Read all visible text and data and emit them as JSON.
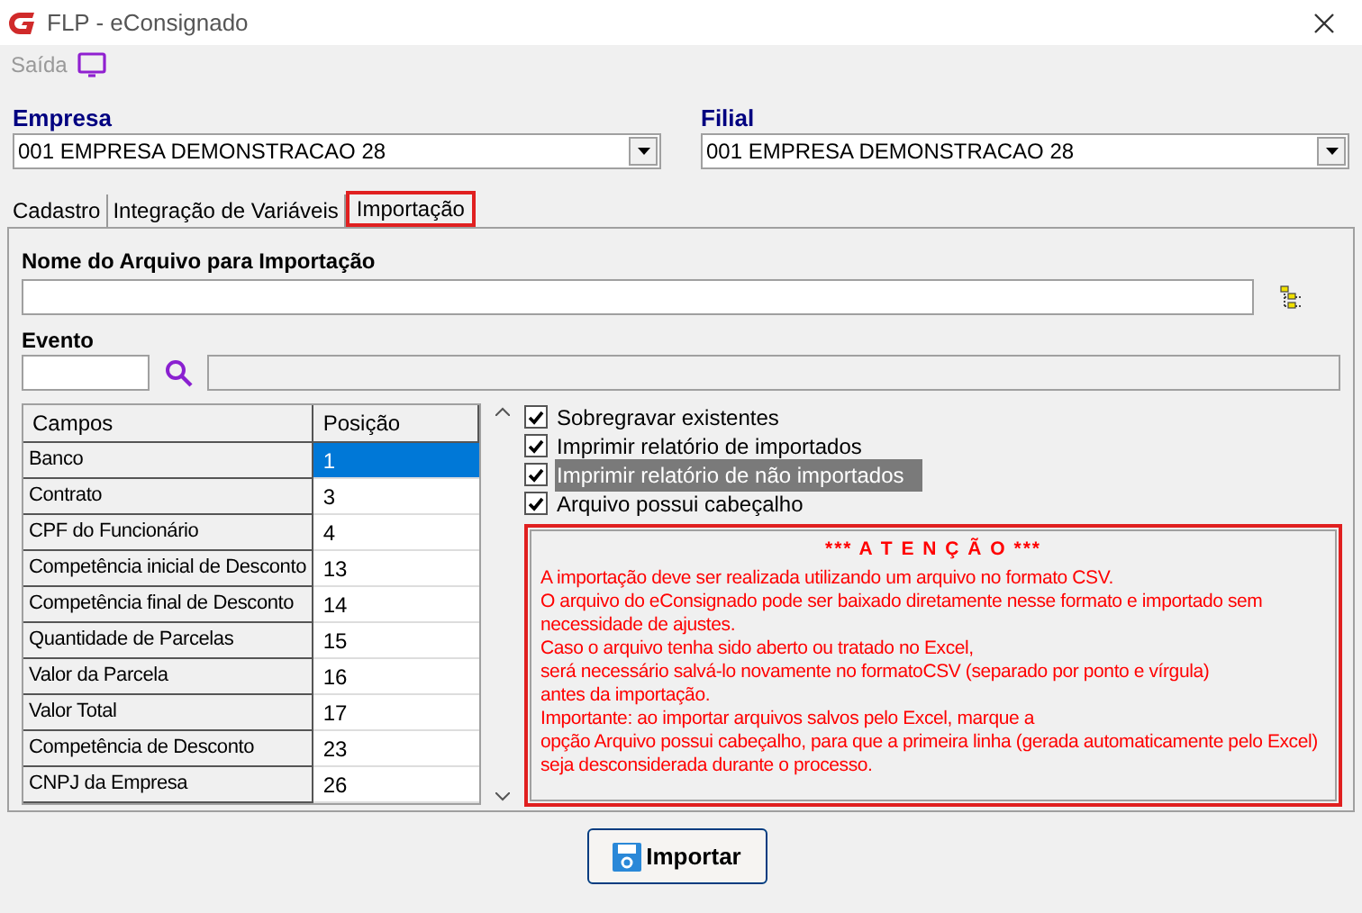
{
  "window": {
    "title": "FLP - eConsignado"
  },
  "toolbar": {
    "label": "Saída"
  },
  "empresa": {
    "label": "Empresa",
    "value": "001 EMPRESA DEMONSTRACAO 28"
  },
  "filial": {
    "label": "Filial",
    "value": "001 EMPRESA DEMONSTRACAO 28"
  },
  "tabs": [
    {
      "label": "Cadastro",
      "selected": false
    },
    {
      "label": "Integração de Variáveis",
      "selected": false
    },
    {
      "label": "Importação",
      "selected": true
    }
  ],
  "file_name": {
    "label": "Nome do Arquivo para Importação"
  },
  "evento": {
    "label": "Evento"
  },
  "table": {
    "columns": [
      "Campos",
      "Posição"
    ],
    "rows": [
      {
        "cells": [
          "Banco",
          "1"
        ],
        "selected": true
      },
      {
        "cells": [
          "Contrato",
          "3"
        ],
        "selected": false
      },
      {
        "cells": [
          "CPF do Funcionário",
          "4"
        ],
        "selected": false
      },
      {
        "cells": [
          "Competência inicial de Desconto",
          "13"
        ],
        "selected": false
      },
      {
        "cells": [
          "Competência final de Desconto",
          "14"
        ],
        "selected": false
      },
      {
        "cells": [
          "Quantidade de Parcelas",
          "15"
        ],
        "selected": false
      },
      {
        "cells": [
          "Valor da Parcela",
          "16"
        ],
        "selected": false
      },
      {
        "cells": [
          "Valor Total",
          "17"
        ],
        "selected": false
      },
      {
        "cells": [
          "Competência de Desconto",
          "23"
        ],
        "selected": false
      },
      {
        "cells": [
          "CNPJ da Empresa",
          "26"
        ],
        "selected": false
      }
    ]
  },
  "options": [
    {
      "label": "Sobregravar existentes",
      "checked": true,
      "focused": false
    },
    {
      "label": "Imprimir relatório de importados",
      "checked": true,
      "focused": false
    },
    {
      "label": "Imprimir relatório de não importados",
      "checked": true,
      "focused": true
    },
    {
      "label": "Arquivo possui cabeçalho",
      "checked": true,
      "focused": false
    }
  ],
  "notice": {
    "title": "*** A T E N Ç Ã O ***",
    "lines": [
      "A importação deve ser realizada utilizando um arquivo no formato CSV.",
      "O arquivo do eConsignado pode ser baixado diretamente nesse formato e importado sem necessidade de ajustes.",
      "Caso o arquivo tenha sido aberto ou tratado no Excel,",
      "será necessário salvá-lo novamente no formatoCSV (separado por ponto e vírgula)",
      "antes da importação.",
      "Importante: ao importar arquivos salvos pelo Excel, marque a",
      "opção Arquivo possui cabeçalho, para que a primeira linha (gerada automaticamente pelo Excel) seja desconsiderada durante o processo."
    ]
  },
  "import_button": {
    "label": "Importar"
  }
}
